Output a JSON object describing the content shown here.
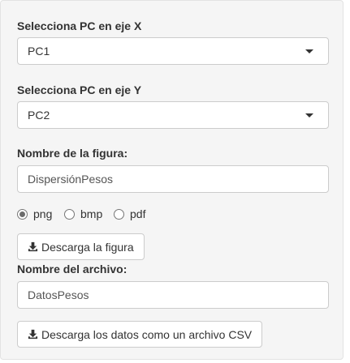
{
  "pc_x": {
    "label": "Selecciona PC en eje X",
    "selected": "PC1"
  },
  "pc_y": {
    "label": "Selecciona PC en eje Y",
    "selected": "PC2"
  },
  "figure": {
    "name_label": "Nombre de la figura:",
    "name_value": "DispersiónPesos",
    "formats": [
      {
        "label": "png",
        "checked": true
      },
      {
        "label": "bmp",
        "checked": false
      },
      {
        "label": "pdf",
        "checked": false
      }
    ],
    "download_label": "Descarga la figura"
  },
  "file": {
    "name_label": "Nombre del archivo:",
    "name_value": "DatosPesos",
    "download_label": "Descarga los datos como un archivo CSV"
  },
  "icons": {
    "download": "download-icon",
    "dropdown": "chevron-down-icon"
  }
}
